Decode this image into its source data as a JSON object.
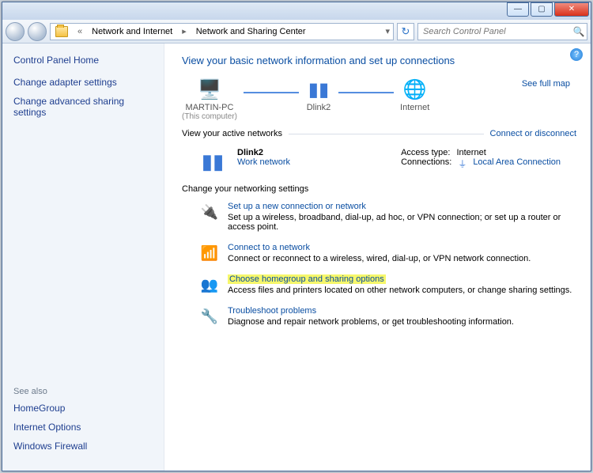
{
  "titlebar": {
    "min": "—",
    "max": "▢",
    "close": "✕"
  },
  "toolbar": {
    "back": "",
    "fwd": "",
    "crumb_prefix": "«",
    "crumb1": "Network and Internet",
    "crumb2": "Network and Sharing Center",
    "refresh": "↻",
    "search_placeholder": "Search Control Panel"
  },
  "help": "?",
  "sidebar": {
    "home": "Control Panel Home",
    "links": [
      "Change adapter settings",
      "Change advanced sharing settings"
    ],
    "seealso_hdr": "See also",
    "seealso": [
      "HomeGroup",
      "Internet Options",
      "Windows Firewall"
    ]
  },
  "main": {
    "title": "View your basic network information and set up connections",
    "maplink": "See full map",
    "nodes": {
      "pc": "MARTIN-PC",
      "pc_sub": "(This computer)",
      "router": "Dlink2",
      "internet": "Internet"
    },
    "active_hdr": "View your active networks",
    "conn_dis": "Connect or disconnect",
    "net": {
      "name": "Dlink2",
      "type": "Work network",
      "access_lbl": "Access type:",
      "access_val": "Internet",
      "conn_lbl": "Connections:",
      "conn_val": "Local Area Connection"
    },
    "settings_hdr": "Change your networking settings",
    "opts": [
      {
        "t": "Set up a new connection or network",
        "d": "Set up a wireless, broadband, dial-up, ad hoc, or VPN connection; or set up a router or access point."
      },
      {
        "t": "Connect to a network",
        "d": "Connect or reconnect to a wireless, wired, dial-up, or VPN network connection."
      },
      {
        "t": "Choose homegroup and sharing options",
        "d": "Access files and printers located on other network computers, or change sharing settings.",
        "hl": true
      },
      {
        "t": "Troubleshoot problems",
        "d": "Diagnose and repair network problems, or get troubleshooting information."
      }
    ]
  }
}
